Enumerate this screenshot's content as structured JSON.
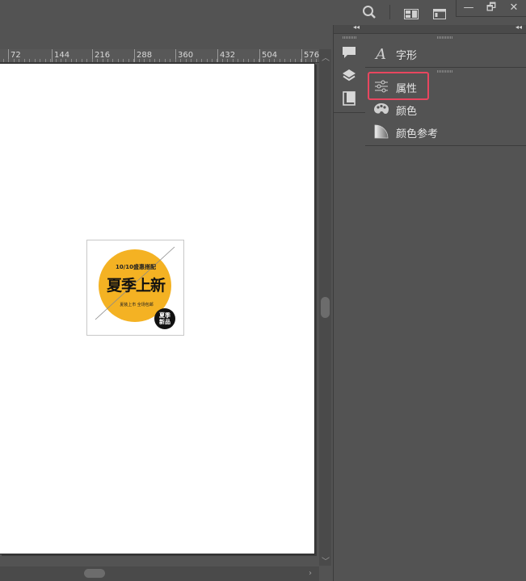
{
  "topbar": {
    "icons": [
      "search-icon",
      "workspace-layout-icon",
      "panel-toggle-icon"
    ],
    "window_controls": {
      "minimize": "—",
      "restore": "🗗",
      "close": "✕"
    }
  },
  "ruler": {
    "labels": [
      "72",
      "144",
      "216",
      "288",
      "360",
      "432",
      "504",
      "576"
    ]
  },
  "artwork": {
    "date_line": "10/10盛惠搭配",
    "headline": "夏季上新",
    "subline": "夏装上市 全场包邮",
    "badge_line1": "夏季",
    "badge_line2": "新品",
    "accent": "#f4b223"
  },
  "dock": {
    "collapse_label": "◂◂",
    "icons": [
      "comment-icon",
      "layers-icon",
      "pages-icon"
    ]
  },
  "panel": {
    "collapse_label": "◂◂",
    "groups": [
      {
        "items": [
          {
            "label": "字形",
            "icon": "glyphs-icon"
          }
        ]
      },
      {
        "items": [
          {
            "label": "属性",
            "icon": "properties-icon"
          },
          {
            "label": "颜色",
            "icon": "color-palette-icon"
          },
          {
            "label": "颜色参考",
            "icon": "color-guide-icon"
          }
        ]
      }
    ],
    "highlight_color": "#e8465f"
  }
}
